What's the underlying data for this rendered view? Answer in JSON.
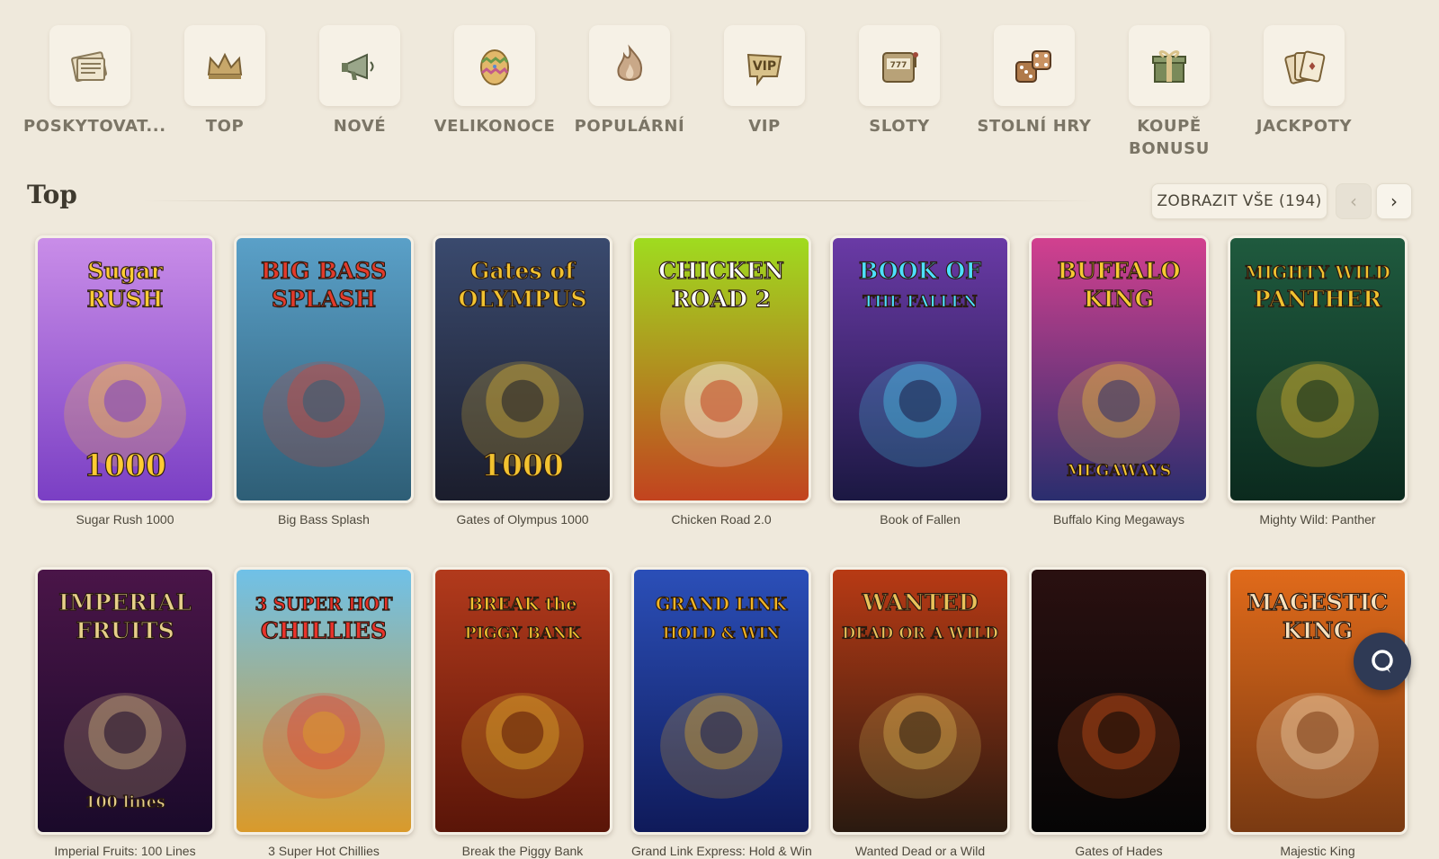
{
  "categories": [
    {
      "label": "POSKYTOVAT...",
      "icon": "newspaper-icon"
    },
    {
      "label": "TOP",
      "icon": "crown-icon"
    },
    {
      "label": "NOVÉ",
      "icon": "megaphone-icon"
    },
    {
      "label": "VELIKONOCE",
      "icon": "easter-egg-icon"
    },
    {
      "label": "POPULÁRNÍ",
      "icon": "flame-icon"
    },
    {
      "label": "VIP",
      "icon": "vip-icon"
    },
    {
      "label": "SLOTY",
      "icon": "slot-machine-icon"
    },
    {
      "label": "STOLNÍ HRY",
      "icon": "dice-icon"
    },
    {
      "label": "KOUPĚ BONUSU",
      "icon": "gift-icon"
    },
    {
      "label": "JACKPOTY",
      "icon": "cards-icon"
    }
  ],
  "section": {
    "title": "Top",
    "view_all": "ZOBRAZIT VŠE (194)",
    "prev": "‹",
    "next": "›"
  },
  "games": [
    {
      "title": "Sugar Rush 1000",
      "art": {
        "bg1": "#c98de8",
        "bg2": "#7a3fc4",
        "text1": "Sugar",
        "text2": "RUSH",
        "text3": "1000",
        "accent": "#ffcc33"
      }
    },
    {
      "title": "Big Bass Splash",
      "art": {
        "bg1": "#5aa0c8",
        "bg2": "#2e5e76",
        "text1": "BIG BASS",
        "text2": "SPLASH",
        "text3": "",
        "accent": "#e23b2b"
      }
    },
    {
      "title": "Gates of Olympus 1000",
      "art": {
        "bg1": "#3a4a6e",
        "bg2": "#1b1d2c",
        "text1": "Gates of",
        "text2": "OLYMPUS",
        "text3": "1000",
        "accent": "#f2c230"
      }
    },
    {
      "title": "Chicken Road 2.0",
      "art": {
        "bg1": "#9fdc1f",
        "bg2": "#c2431f",
        "text1": "CHICKEN",
        "text2": "ROAD 2",
        "text3": "",
        "accent": "#ffffff"
      }
    },
    {
      "title": "Book of Fallen",
      "art": {
        "bg1": "#6a3aa6",
        "bg2": "#1b1842",
        "text1": "BOOK OF",
        "text2": "THE FALLEN",
        "text3": "",
        "accent": "#4de0ff"
      }
    },
    {
      "title": "Buffalo King Megaways",
      "art": {
        "bg1": "#d2408f",
        "bg2": "#2a2e6e",
        "text1": "BUFFALO",
        "text2": "KING",
        "text3": "MEGAWAYS",
        "accent": "#f7c933"
      }
    },
    {
      "title": "Mighty Wild: Panther",
      "art": {
        "bg1": "#1f5a3e",
        "bg2": "#0b2a1e",
        "text1": "MIGHTY WILD",
        "text2": "PANTHER",
        "text3": "",
        "accent": "#f2c230"
      }
    },
    {
      "title": "Imperial Fruits: 100 Lines",
      "art": {
        "bg1": "#4a1548",
        "bg2": "#1a0a2a",
        "text1": "IMPERIAL",
        "text2": "FRUITS",
        "text3": "100 lines",
        "accent": "#e7cf8a"
      }
    },
    {
      "title": "3 Super Hot Chillies",
      "art": {
        "bg1": "#6fc1e8",
        "bg2": "#d99a2b",
        "text1": "3 SUPER HOT",
        "text2": "CHILLIES",
        "text3": "",
        "accent": "#e8342b"
      }
    },
    {
      "title": "Break the Piggy Bank",
      "art": {
        "bg1": "#b23a1c",
        "bg2": "#5a1508",
        "text1": "BREAK the",
        "text2": "PIGGY BANK",
        "text3": "",
        "accent": "#f2c230"
      }
    },
    {
      "title": "Grand Link Express: Hold & Win",
      "art": {
        "bg1": "#2b4fb8",
        "bg2": "#0f1a5a",
        "text1": "GRAND LINK",
        "text2": "HOLD & WIN",
        "text3": "",
        "accent": "#f2b523"
      }
    },
    {
      "title": "Wanted Dead or a Wild",
      "art": {
        "bg1": "#b83a14",
        "bg2": "#2a1a10",
        "text1": "WANTED",
        "text2": "DEAD OR A WILD",
        "text3": "",
        "accent": "#e9c25a"
      }
    },
    {
      "title": "Gates of Hades",
      "art": {
        "bg1": "#2a1010",
        "bg2": "#050505",
        "text1": "",
        "text2": "",
        "text3": "",
        "accent": "#e05a1a"
      }
    },
    {
      "title": "Majestic King",
      "art": {
        "bg1": "#e06a1a",
        "bg2": "#7a3a12",
        "text1": "MAGESTIC",
        "text2": "KING",
        "text3": "",
        "accent": "#f6e2c0"
      }
    }
  ],
  "chat": {
    "icon": "chat-icon"
  }
}
